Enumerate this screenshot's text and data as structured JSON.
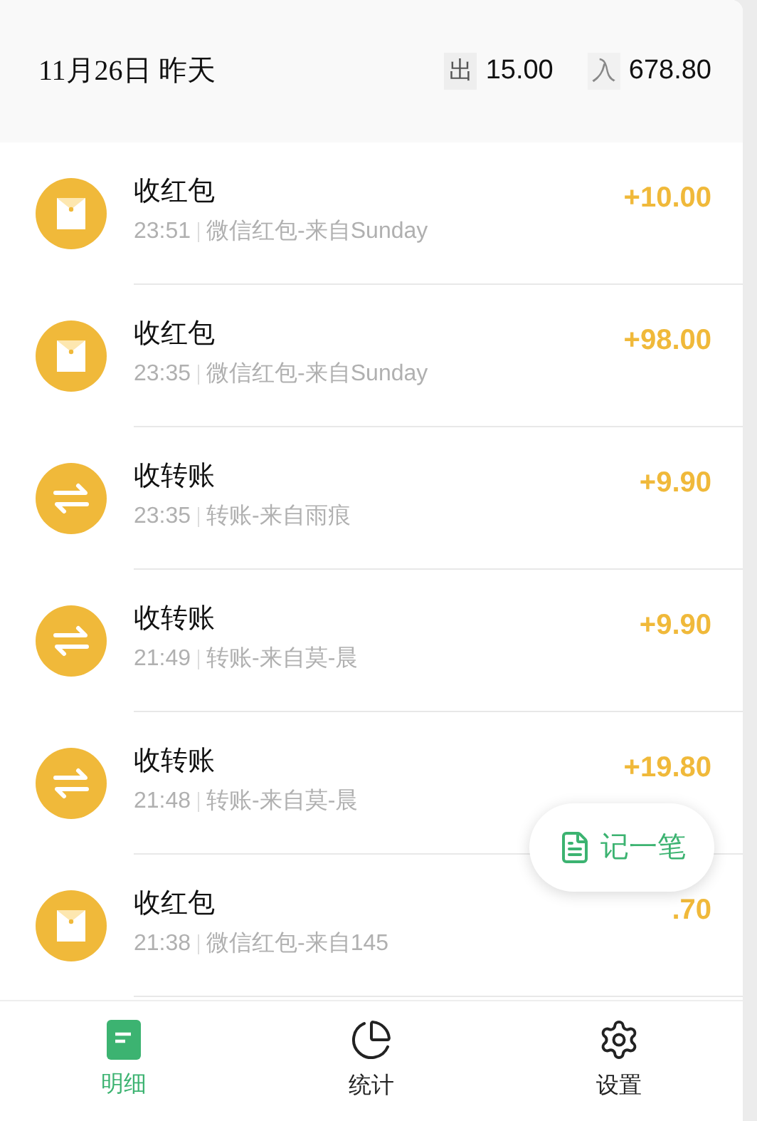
{
  "header": {
    "date": "11月26日 昨天",
    "out_label": "出",
    "out_amount": "15.00",
    "in_label": "入",
    "in_amount": "678.80"
  },
  "records": [
    {
      "kind": "red_packet",
      "title": "收红包",
      "time": "23:51",
      "note": "微信红包-来自Sunday",
      "amount": "+10.00"
    },
    {
      "kind": "red_packet",
      "title": "收红包",
      "time": "23:35",
      "note": "微信红包-来自Sunday",
      "amount": "+98.00"
    },
    {
      "kind": "transfer",
      "title": "收转账",
      "time": "23:35",
      "note": "转账-来自雨痕",
      "amount": "+9.90"
    },
    {
      "kind": "transfer",
      "title": "收转账",
      "time": "21:49",
      "note": "转账-来自莫-晨",
      "amount": "+9.90"
    },
    {
      "kind": "transfer",
      "title": "收转账",
      "time": "21:48",
      "note": "转账-来自莫-晨",
      "amount": "+19.80"
    },
    {
      "kind": "red_packet",
      "title": "收红包",
      "time": "21:38",
      "note": "微信红包-来自145",
      "amount": ".70"
    }
  ],
  "fab": {
    "label": "记一笔"
  },
  "nav": [
    {
      "kind": "list",
      "label": "明细",
      "selected": true
    },
    {
      "kind": "chart",
      "label": "统计",
      "selected": false
    },
    {
      "kind": "settings",
      "label": "设置",
      "selected": false
    }
  ]
}
